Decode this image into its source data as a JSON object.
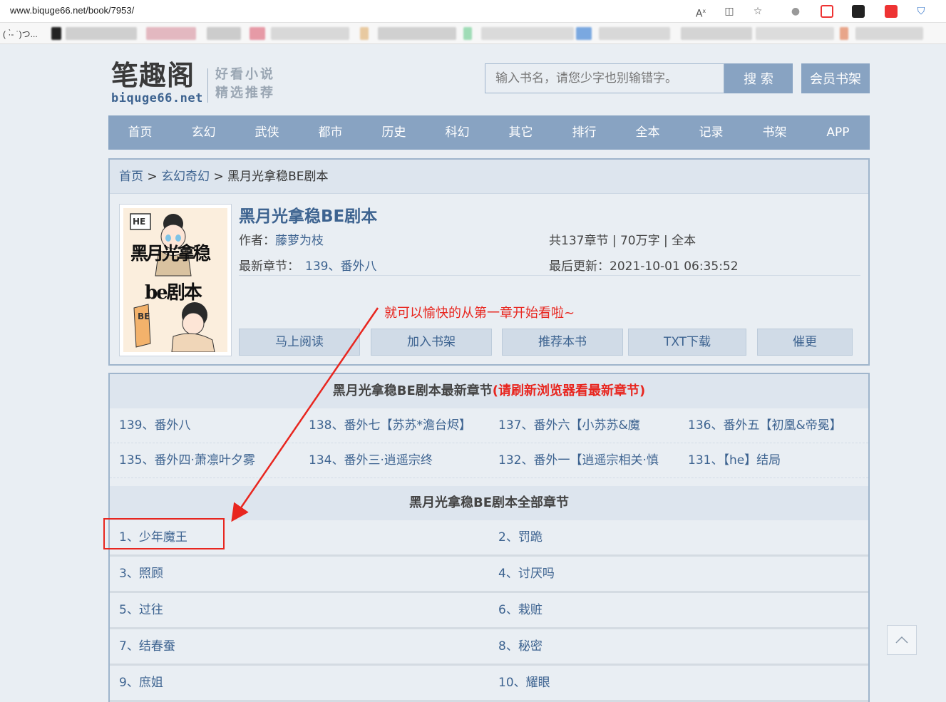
{
  "browser": {
    "url": "www.biquge66.net/book/7953/",
    "bookmark_first": "( ·̀- ˙)つ..."
  },
  "header": {
    "logo_cn": "笔趣阁",
    "logo_en": "biquge66.net",
    "tagline_1": "好看小说",
    "tagline_2": "精选推荐",
    "search_placeholder": "输入书名，请您少字也别输错字。",
    "search_button": "搜 索",
    "member_button": "会员书架"
  },
  "nav": [
    "首页",
    "玄幻",
    "武侠",
    "都市",
    "历史",
    "科幻",
    "其它",
    "排行",
    "全本",
    "记录",
    "书架",
    "APP"
  ],
  "breadcrumb": {
    "home": "首页",
    "sep": " > ",
    "category": "玄幻奇幻",
    "current": "黑月光拿稳BE剧本"
  },
  "book": {
    "title": "黑月光拿稳BE剧本",
    "author_label": "作者：",
    "author": "藤萝为枝",
    "stats": "共137章节 | 70万字 | 全本",
    "latest_label": "最新章节：",
    "latest_chapter": "139、番外八",
    "updated": "最后更新：2021-10-01 06:35:52",
    "cover_text_1": "黑月光拿稳",
    "cover_text_2": "be剧本",
    "cover_badge_1": "HE",
    "cover_badge_2": "BE"
  },
  "buttons": [
    "马上阅读",
    "加入书架",
    "推荐本书",
    "TXT下载",
    "催更"
  ],
  "annotation": "就可以愉快的从第一章开始看啦~",
  "latest_section": {
    "title": "黑月光拿稳BE剧本最新章节",
    "note": "(请刷新浏览器看最新章节)",
    "rows": [
      [
        "139、番外八",
        "138、番外七【苏苏*澹台烬】",
        "137、番外六【小苏苏&魔",
        "136、番外五【初凰&帝冕】"
      ],
      [
        "135、番外四·萧凛叶夕雾",
        "134、番外三·逍遥宗终",
        "132、番外一【逍遥宗相关·慎",
        "131、【he】结局"
      ]
    ]
  },
  "all_section": {
    "title": "黑月光拿稳BE剧本全部章节",
    "rows": [
      [
        "1、少年魔王",
        "2、罚跪"
      ],
      [
        "3、照顾",
        "4、讨厌吗"
      ],
      [
        "5、过往",
        "6、栽赃"
      ],
      [
        "7、结春蚕",
        "8、秘密"
      ],
      [
        "9、庶姐",
        "10、耀眼"
      ]
    ]
  },
  "colors": {
    "accent": "#88a3c2",
    "link": "#3d6390",
    "annotation": "#e8261f",
    "background": "#e9eef3"
  }
}
